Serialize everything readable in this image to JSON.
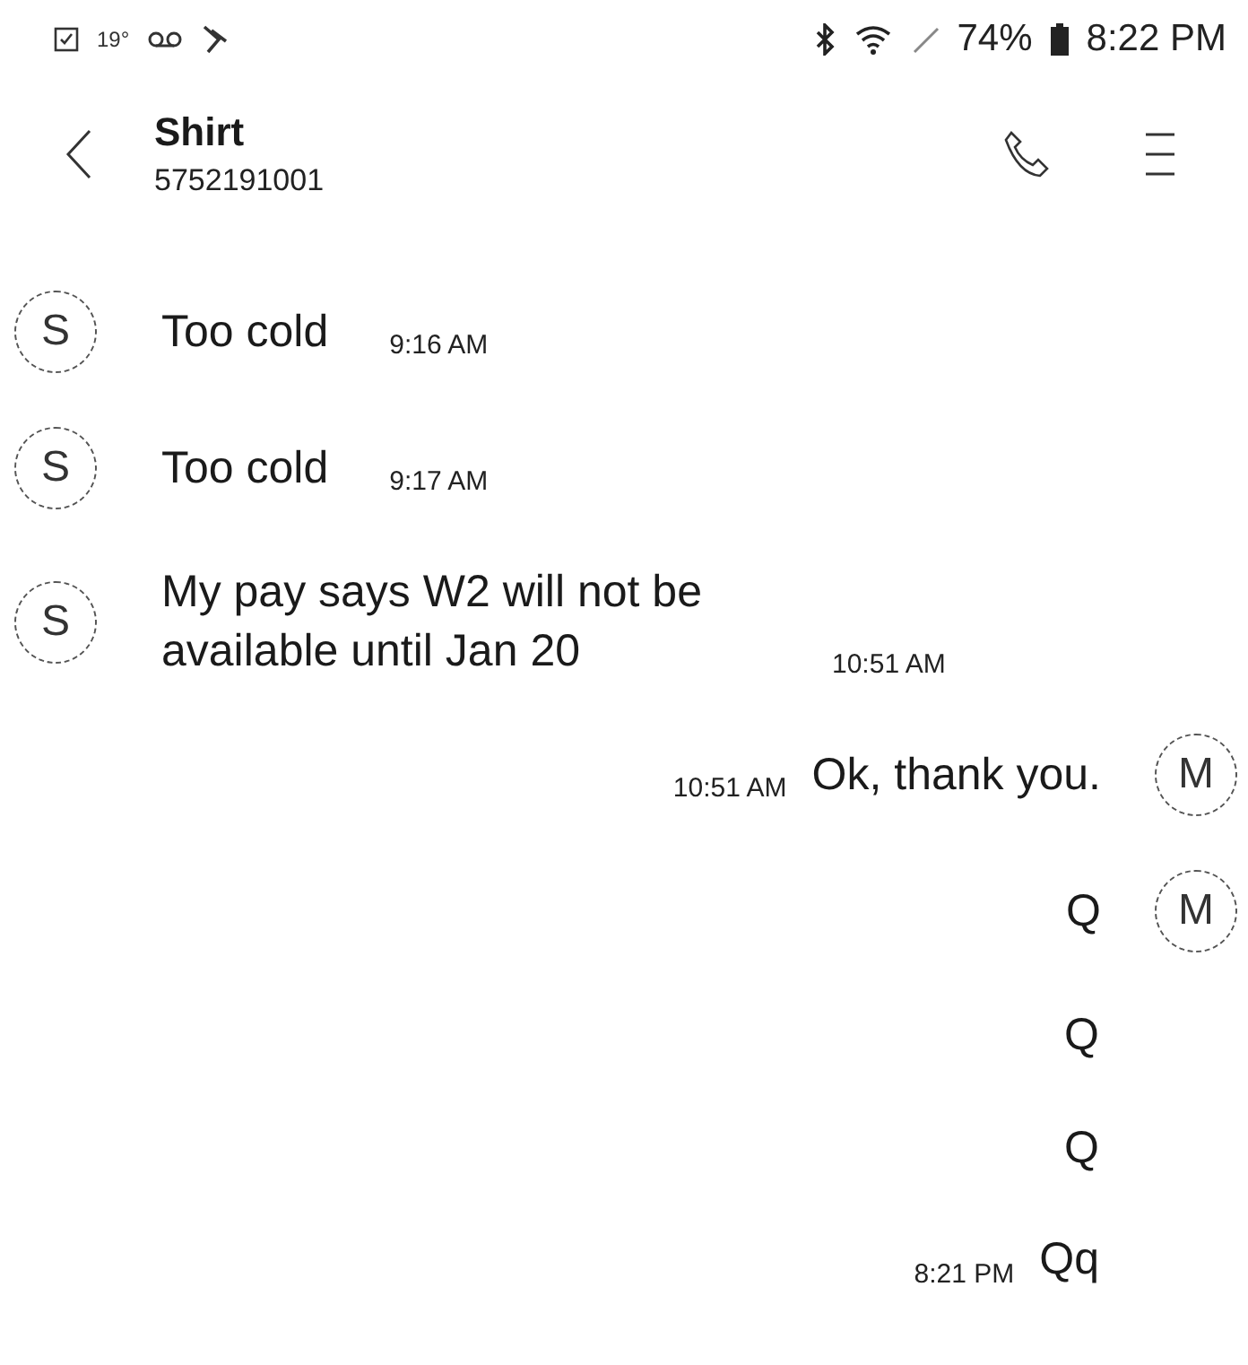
{
  "status_bar": {
    "temperature": "19°",
    "battery": "74%",
    "time": "8:22 PM"
  },
  "header": {
    "title": "Shirt",
    "subtitle": "5752191001"
  },
  "messages": [
    {
      "kind": "incoming",
      "avatar": "S",
      "text": "Too cold",
      "time": "9:16 AM"
    },
    {
      "kind": "incoming",
      "avatar": "S",
      "text": "Too cold",
      "time": "9:17 AM"
    },
    {
      "kind": "incoming",
      "avatar": "S",
      "text": "My pay says W2 will not be available until Jan 20",
      "time": "10:51 AM"
    },
    {
      "kind": "outgoing",
      "avatar": "M",
      "text": "Ok, thank you.",
      "time": "10:51 AM"
    },
    {
      "kind": "outgoing",
      "avatar": "M",
      "text": "Q"
    },
    {
      "kind": "outgoing",
      "text": "Q"
    },
    {
      "kind": "outgoing",
      "text": "Q"
    },
    {
      "kind": "outgoing",
      "text": "Qq",
      "time": "8:21 PM"
    }
  ]
}
